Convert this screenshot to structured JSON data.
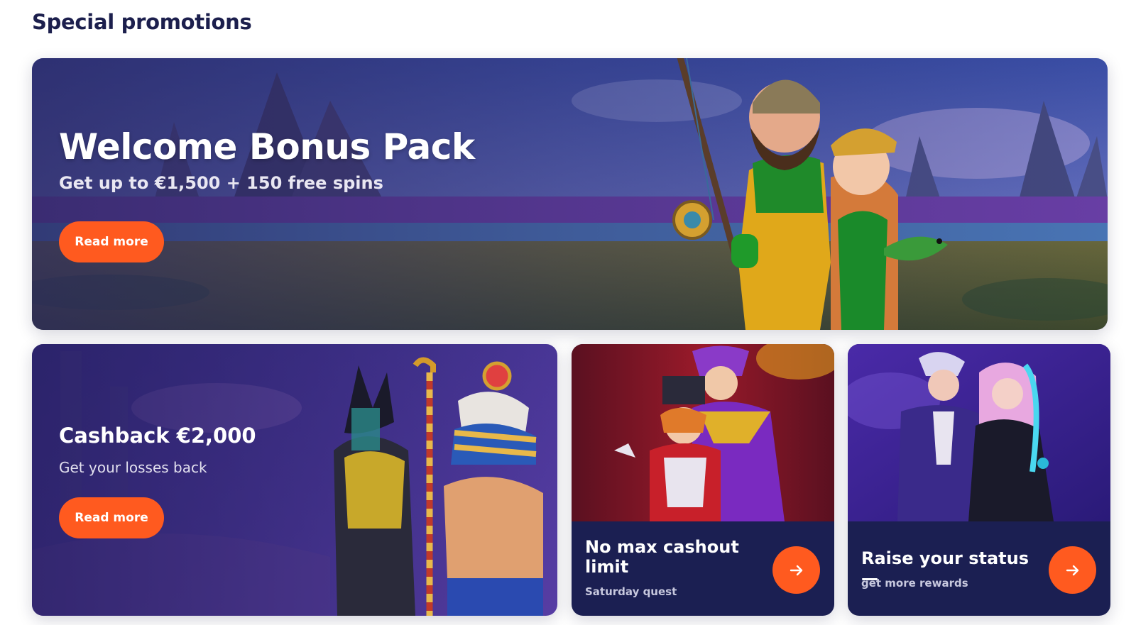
{
  "section": {
    "title": "Special promotions"
  },
  "hero": {
    "title": "Welcome Bonus Pack",
    "subtitle": "Get up to €1,500 + 150 free spins",
    "button_label": "Read more"
  },
  "cashback": {
    "title": "Cashback €2,000",
    "subtitle": "Get your losses back",
    "button_label": "Read more"
  },
  "quest_card": {
    "title": "No max cashout limit",
    "subtitle": "Saturday quest",
    "button_icon": "arrow-right-icon"
  },
  "status_card": {
    "title": "Raise your status —",
    "subtitle": "get more rewards",
    "button_icon": "arrow-right-icon"
  },
  "colors": {
    "accent": "#ff5a1f",
    "title_dark": "#1c1f4d",
    "card_navy": "#1b1f52"
  }
}
